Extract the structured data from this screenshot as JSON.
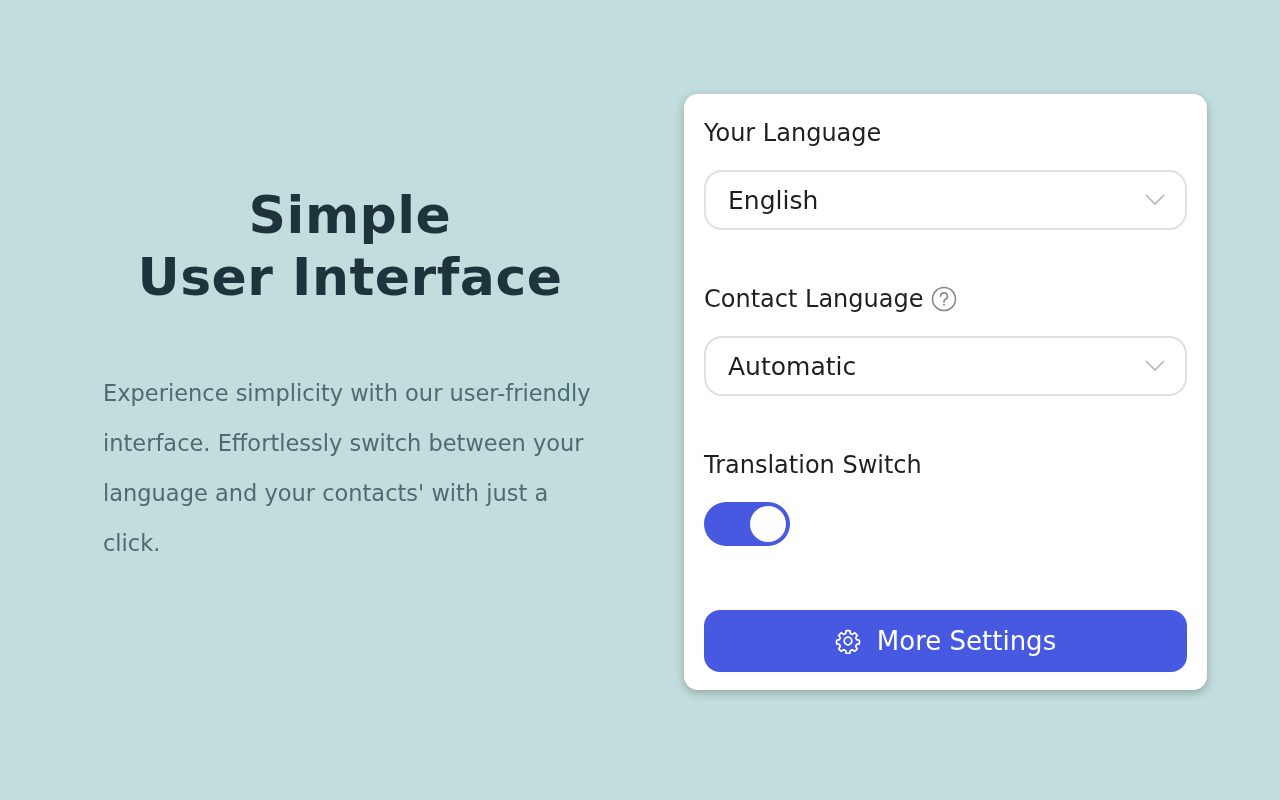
{
  "hero": {
    "title_lines": [
      "Simple",
      "User Interface"
    ],
    "description": "Experience simplicity with our user-friendly interface. Effortlessly switch between your language and your contacts' with just a click."
  },
  "settings": {
    "fields": [
      {
        "kind": "select",
        "label": "Your Language",
        "help": false,
        "value": "English"
      },
      {
        "kind": "select",
        "label": "Contact Language",
        "help": true,
        "value": "Automatic"
      },
      {
        "kind": "toggle",
        "label": "Translation Switch",
        "on": true
      }
    ],
    "button": {
      "label": "More Settings"
    }
  }
}
